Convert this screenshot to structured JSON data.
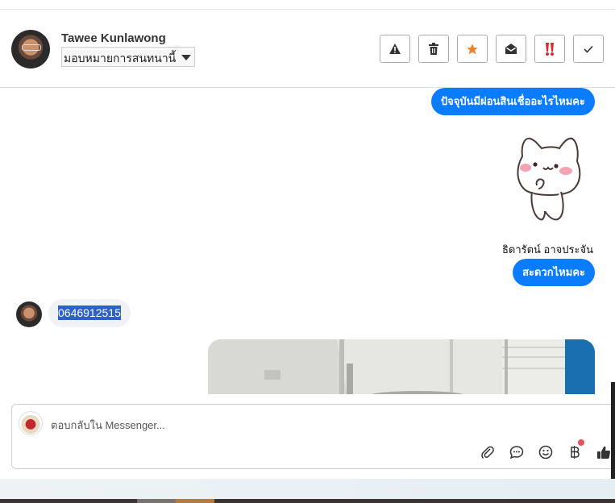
{
  "header": {
    "contact_name": "Tawee Kunlawong",
    "assign_label": "มอบหมายการสนทนานี้",
    "actions": [
      {
        "name": "mark-spam",
        "icon": "warning-icon"
      },
      {
        "name": "delete",
        "icon": "trash-icon"
      },
      {
        "name": "star",
        "icon": "star-icon"
      },
      {
        "name": "mark-unread",
        "icon": "envelope-open-icon"
      },
      {
        "name": "priority",
        "icon": "double-exclamation-icon"
      },
      {
        "name": "done",
        "icon": "check-icon"
      }
    ],
    "colors": {
      "star": "#f0812a",
      "priority": "#e0252b"
    }
  },
  "conversation": {
    "messages": [
      {
        "direction": "outgoing",
        "text": "ปัจจุบันมีผ่อนสินเชื่ออะไรไหมคะ"
      },
      {
        "direction": "outgoing",
        "type": "sticker",
        "sticker": "cat-sticker"
      },
      {
        "direction": "outgoing",
        "sender": "ธิดารัตน์ อาจประจัน",
        "text": "สะดวกไหมคะ"
      },
      {
        "direction": "incoming",
        "text": "0646912515",
        "selected": true
      },
      {
        "direction": "outgoing",
        "type": "photo"
      }
    ],
    "colors": {
      "outgoing_bubble": "#0a7cff",
      "incoming_bubble": "#f0f2f5",
      "selection": "#2b62c9"
    }
  },
  "composer": {
    "placeholder": "ตอบกลับใน Messenger...",
    "tools": [
      "paperclip-icon",
      "chat-bubble-icon",
      "smiley-icon",
      "baht-icon",
      "thumbs-up-icon"
    ]
  }
}
